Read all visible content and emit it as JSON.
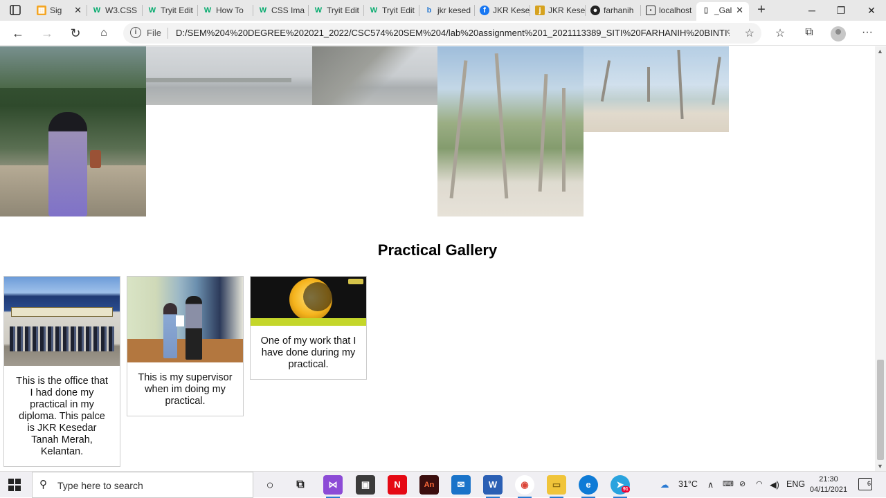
{
  "browser": {
    "tabs": [
      {
        "label": "Sig",
        "favicon": "grid-icon",
        "favicon_color": "#f4a522"
      },
      {
        "label": "W3.CSS",
        "favicon": "w3schools-icon",
        "favicon_color": "#04aa6d"
      },
      {
        "label": "Tryit Edit",
        "favicon": "w3schools-icon",
        "favicon_color": "#04aa6d"
      },
      {
        "label": "How To",
        "favicon": "w3schools-icon",
        "favicon_color": "#04aa6d"
      },
      {
        "label": "CSS Ima",
        "favicon": "w3schools-icon",
        "favicon_color": "#04aa6d"
      },
      {
        "label": "Tryit Edit",
        "favicon": "w3schools-icon",
        "favicon_color": "#04aa6d"
      },
      {
        "label": "Tryit Edit",
        "favicon": "w3schools-icon",
        "favicon_color": "#04aa6d"
      },
      {
        "label": "jkr kesed",
        "favicon": "bing-icon",
        "favicon_color": "#2a7ad2"
      },
      {
        "label": "JKR Kese",
        "favicon": "facebook-icon",
        "favicon_color": "#1877f2"
      },
      {
        "label": "JKR Kese",
        "favicon": "jkr-icon",
        "favicon_color": "#d6a21f"
      },
      {
        "label": "farhanih",
        "favicon": "github-icon",
        "favicon_color": "#222222"
      },
      {
        "label": "localhost",
        "favicon": "localhost-icon",
        "favicon_color": "#222222"
      },
      {
        "label": "_Gal",
        "favicon": "page-icon",
        "favicon_color": "#555555",
        "active": true
      }
    ],
    "address": {
      "scheme_label": "File",
      "url": "D:/SEM%204%20DEGREE%202021_2022/CSC574%20SEM%204/lab%20assignment%201_2021113389_SITI%20FARHANIH%20BINTI%20A..."
    }
  },
  "page": {
    "gallery_heading": "Practical Gallery",
    "cards": [
      {
        "description": "This is the office that I had done my practical in my diploma. This palce is JKR Kesedar Tanah Merah, Kelantan."
      },
      {
        "description": "This is my supervisor when im doing my practical."
      },
      {
        "description": "One of my work that I have done during my practical."
      }
    ]
  },
  "taskbar": {
    "search_placeholder": "Type here to search",
    "weather": "31°C",
    "language": "ENG",
    "time": "21:30",
    "date": "04/11/2021",
    "notification_count": "6",
    "telegram_badge": "91"
  }
}
